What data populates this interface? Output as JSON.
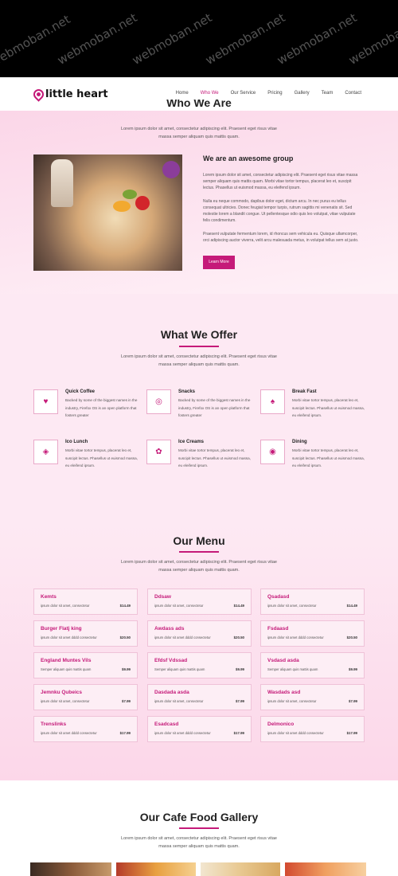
{
  "watermark": "webmoban.net",
  "brand": {
    "name": "little heart",
    "color": "#c51a79"
  },
  "nav": [
    "Home",
    "Who We",
    "Our Service",
    "Pricing",
    "Gallery",
    "Team",
    "Contact"
  ],
  "nav_active": "Who We",
  "about": {
    "title": "Who We Are",
    "desc": "Lorem ipsum dolor sit amet, consectetur adipiscing elit. Praesent eget risus vitae massa semper aliquam quis mattis quam.",
    "heading": "We are an awesome group",
    "p1": "Lorem ipsum dolor sit amet, consectetur adipiscing elit. Praesent eget risus vitae massa semper aliquam quis mattis quam. Morbi vitae tortor tempus, placerat leo et, suscipit lectus. Phasellus ut euismod massa, eu eleifend ipsum.",
    "p2": "Nulla eu neque commodo, dapibus dolor eget, dictum arcu. In nec purus eu tellus consequat ultricies. Donec feugiat tempor turpis, rutrum sagittis mi venenatis sit. Sed molestie lorem a blandit congue. Ut pellentesque odio quis leo volutpat, vitae vulputate felis condimentum.",
    "p3": "Praesent vulputate fermentum lorem, id rhoncus sem vehicula eu. Quisque ullamcorper, orci adipiscing auctor viverra, velit arcu malesuada metus, in volutpat tellus sem at justo.",
    "button": "Learn More"
  },
  "offer": {
    "title": "What We Offer",
    "desc": "Lorem ipsum dolor sit amet, consectetur adipiscing elit. Praesent eget risus vitae massa semper aliquam quis mattis quam.",
    "items": [
      {
        "icon": "heart-icon",
        "glyph": "♥",
        "title": "Quick Coffee",
        "text": "Backed by some of the biggest names in the industry, Firefox OS is an open platform that fosters greater"
      },
      {
        "icon": "swirl-icon",
        "glyph": "◎",
        "title": "Snacks",
        "text": "Backed by some of the biggest names in the industry, Firefox OS is an open platform that fosters greater"
      },
      {
        "icon": "bell-icon",
        "glyph": "♠",
        "title": "Break Fast",
        "text": "Morbi vitae tortor tempus, placerat leo et, suscipit lectus. Phasellus ut euismod massa, eu eleifend ipsum."
      },
      {
        "icon": "box-icon",
        "glyph": "◈",
        "title": "Ico Lunch",
        "text": "Morbi vitae tortor tempus, placerat leo et, suscipit lectus. Phasellus ut euismod massa, eu eleifend ipsum."
      },
      {
        "icon": "flower-icon",
        "glyph": "✿",
        "title": "Ice Creams",
        "text": "Morbi vitae tortor tempus, placerat leo et, suscipit lectus. Phasellus ut euismod massa, eu eleifend ipsum."
      },
      {
        "icon": "lifebuoy-icon",
        "glyph": "◉",
        "title": "Dining",
        "text": "Morbi vitae tortor tempus, placerat leo et, suscipit lectus. Phasellus ut euismod massa, eu eleifend ipsum."
      }
    ]
  },
  "menu": {
    "title": "Our Menu",
    "desc": "Lorem ipsum dolor sit amet, consectetur adipiscing elit. Praesent eget risus vitae massa semper aliquam quis mattis quam.",
    "items": [
      {
        "name": "Kemts",
        "desc": "ipsum dolor sit amet, consectetur",
        "price": "$14.49"
      },
      {
        "name": "Ddsaw",
        "desc": "ipsum dolor sit amet, consectetur",
        "price": "$14.49"
      },
      {
        "name": "Qsadasd",
        "desc": "ipsum dolor sit amet, consectetur",
        "price": "$14.49"
      },
      {
        "name": "Burger Flatj king",
        "desc": "ipsum dolor sit amet dddd consectetur",
        "price": "$20.50"
      },
      {
        "name": "Awdass ads",
        "desc": "ipsum dolor sit amet dddd consectetur",
        "price": "$20.50"
      },
      {
        "name": "Fsdaasd",
        "desc": "ipsum dolor sit amet dddd consectetur",
        "price": "$20.50"
      },
      {
        "name": "England Muntes Vils",
        "desc": "Semper aliquam quis mattis quam",
        "price": "$9.99"
      },
      {
        "name": "Efdsf Vdssad",
        "desc": "Semper aliquam quis mattis quam",
        "price": "$9.99"
      },
      {
        "name": "Vsdasd asda",
        "desc": "Semper aliquam quis mattis quam",
        "price": "$9.99"
      },
      {
        "name": "Jemnku Qubeics",
        "desc": "ipsum dolor sit amet, consectetur",
        "price": "$7.99"
      },
      {
        "name": "Dasdada asda",
        "desc": "ipsum dolor sit amet, consectetur",
        "price": "$7.99"
      },
      {
        "name": "Wasdads asd",
        "desc": "ipsum dolor sit amet, consectetur",
        "price": "$7.99"
      },
      {
        "name": "Trenslinks",
        "desc": "ipsum dolor sit amet dddd consectetur",
        "price": "$17.99"
      },
      {
        "name": "Esadcasd",
        "desc": "ipsum dolor sit amet dddd consectetur",
        "price": "$17.99"
      },
      {
        "name": "Delmonico",
        "desc": "ipsum dolor sit amet dddd consectetur",
        "price": "$17.99"
      }
    ]
  },
  "gallery": {
    "title": "Our Cafe Food Gallery",
    "desc": "Lorem ipsum dolor sit amet, consectetur adipiscing elit. Praesent eget risus vitae massa semper aliquam quis mattis quam."
  }
}
